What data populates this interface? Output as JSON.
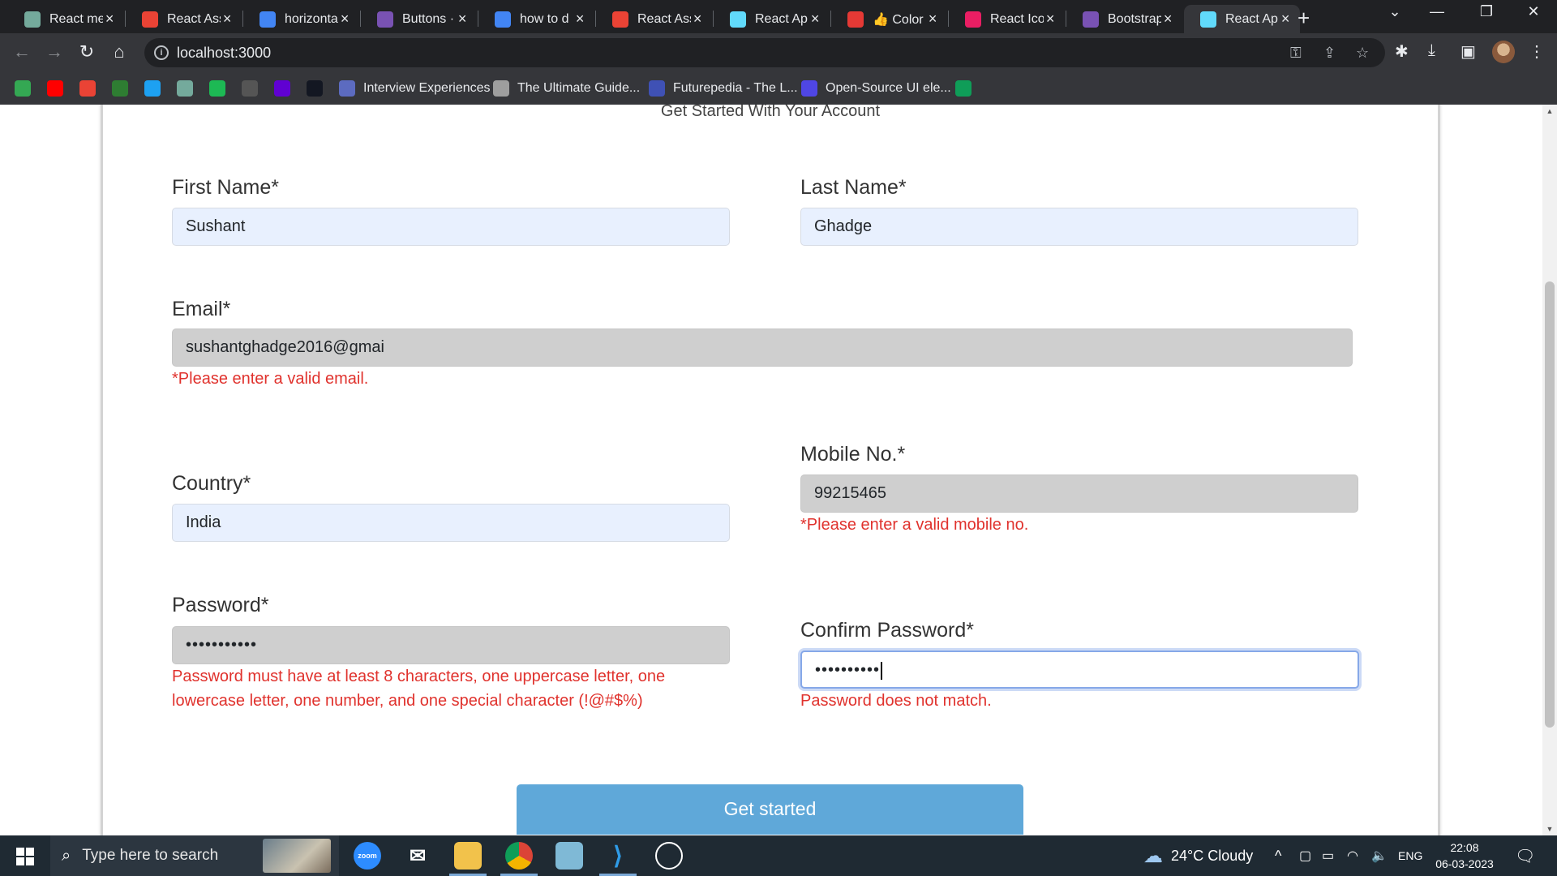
{
  "browser": {
    "tabs": [
      {
        "label": "React me",
        "icon": "chatgpt-icon",
        "color": "#74aa9c"
      },
      {
        "label": "React Ass",
        "icon": "gmail-icon",
        "color": "#ea4335"
      },
      {
        "label": "horizonta",
        "icon": "google-icon",
        "color": "#4285f4"
      },
      {
        "label": "Buttons ·",
        "icon": "bootstrap-icon",
        "color": "#7952b3"
      },
      {
        "label": "how to d",
        "icon": "google-icon",
        "color": "#4285f4"
      },
      {
        "label": "React Ass",
        "icon": "gmail-icon",
        "color": "#ea4335"
      },
      {
        "label": "React Ap",
        "icon": "react-icon",
        "color": "#61dafb"
      },
      {
        "label": "👍 Color",
        "icon": "color-icon",
        "color": "#e53935"
      },
      {
        "label": "React Ico",
        "icon": "react-icons-icon",
        "color": "#e91e63"
      },
      {
        "label": "Bootstrap",
        "icon": "bootstrap-icon",
        "color": "#7952b3"
      },
      {
        "label": "React Ap",
        "icon": "react-icon",
        "color": "#61dafb"
      }
    ],
    "active_tab_index": 10,
    "url": "localhost:3000",
    "bookmarks": [
      {
        "label": "",
        "icon": "maps-icon",
        "color": "#34a853"
      },
      {
        "label": "",
        "icon": "youtube-icon",
        "color": "#ff0000"
      },
      {
        "label": "",
        "icon": "gmail-icon",
        "color": "#ea4335"
      },
      {
        "label": "",
        "icon": "one-icon",
        "color": "#2e7d32"
      },
      {
        "label": "",
        "icon": "twitter-icon",
        "color": "#1da1f2"
      },
      {
        "label": "",
        "icon": "chatgpt-icon",
        "color": "#74aa9c"
      },
      {
        "label": "",
        "icon": "spotify-icon",
        "color": "#1db954"
      },
      {
        "label": "",
        "icon": "cc-icon",
        "color": "#555555"
      },
      {
        "label": "",
        "icon": "yahoo-icon",
        "color": "#6001d2"
      },
      {
        "label": "",
        "icon": "tradingview-icon",
        "color": "#131722"
      },
      {
        "label": "Interview Experiences",
        "icon": "list-icon",
        "color": "#5c6bc0"
      },
      {
        "label": "The Ultimate Guide...",
        "icon": "mountain-icon",
        "color": "#9e9e9e"
      },
      {
        "label": "Futurepedia - The L...",
        "icon": "futurepedia-icon",
        "color": "#3f51b5"
      },
      {
        "label": "Open-Source UI ele...",
        "icon": "ui-icon",
        "color": "#4f46e5"
      },
      {
        "label": "",
        "icon": "sheets-icon",
        "color": "#0f9d58"
      }
    ]
  },
  "form": {
    "subtitle": "Get Started With Your Account",
    "first_name": {
      "label": "First Name*",
      "value": "Sushant"
    },
    "last_name": {
      "label": "Last Name*",
      "value": "Ghadge"
    },
    "email": {
      "label": "Email*",
      "value": "sushantghadge2016@gmai",
      "error": "*Please enter a valid email."
    },
    "country": {
      "label": "Country*",
      "value": "India"
    },
    "mobile": {
      "label": "Mobile No.*",
      "value": "99215465",
      "error": "*Please enter a valid mobile no."
    },
    "password": {
      "label": "Password*",
      "masked": "•••••••••••",
      "error": "Password must have at least 8 characters, one uppercase letter, one lowercase letter, one number, and one special character (!@#$%)"
    },
    "confirm_password": {
      "label": "Confirm Password*",
      "masked": "••••••••••",
      "error": "Password does not match."
    },
    "submit_label": "Get started",
    "error_color": "#e0322d",
    "button_color": "#5fa8d9"
  },
  "taskbar": {
    "search_placeholder": "Type here to search",
    "apps": [
      "zoom-icon",
      "mail-icon",
      "file-explorer-icon",
      "chrome-icon",
      "notepad-icon",
      "vscode-icon",
      "app-icon"
    ],
    "zoom_label": "zoom",
    "weather": "24°C  Cloudy",
    "language": "ENG",
    "time": "22:08",
    "date": "06-03-2023"
  }
}
